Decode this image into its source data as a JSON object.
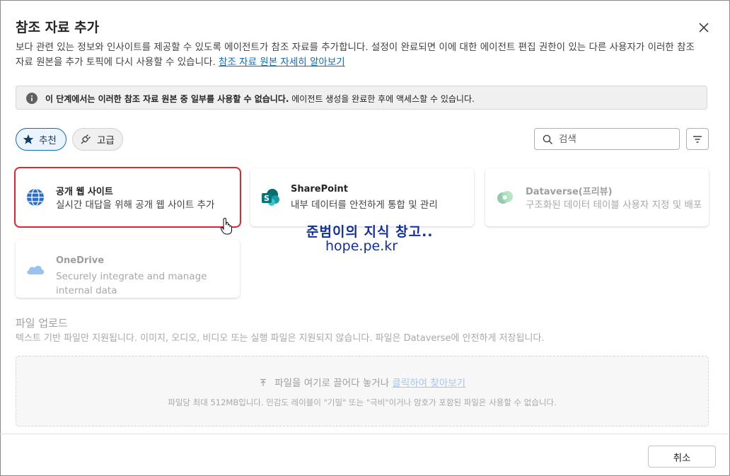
{
  "dialog": {
    "title": "참조 자료 추가",
    "description": "보다 관련 있는 정보와 인사이트를 제공할 수 있도록 에이전트가 참조 자료를 추가합니다. 설정이 완료되면 이에 대한 에이전트 편집 권한이 있는 다른 사용자가 이러한 참조 자료 원본을 추가 토픽에 다시 사용할 수 있습니다.",
    "learn_more_link": "참조 자료 원본 자세히 알아보기"
  },
  "info_banner": {
    "bold_text": "이 단계에서는 이러한 참조 자료 원본 중 일부를 사용할 수 없습니다.",
    "text": "에이전트 생성을 완료한 후에 액세스할 수 있습니다."
  },
  "filters": {
    "recommended": "추천",
    "advanced": "고급",
    "search_placeholder": "검색"
  },
  "sources": [
    {
      "name": "공개 웹 사이트",
      "description": "실시간 대답을 위해 공개 웹 사이트 추가",
      "icon": "globe-icon"
    },
    {
      "name": "SharePoint",
      "description": "내부 데이터를 안전하게 통합 및 관리",
      "icon": "sharepoint-icon"
    },
    {
      "name": "Dataverse(프리뷰)",
      "description": "구조화된 데이터 테이블 사용자 지정 및 배포",
      "icon": "dataverse-icon"
    },
    {
      "name": "OneDrive",
      "description": "Securely integrate and manage internal data",
      "icon": "onedrive-icon"
    }
  ],
  "watermark": {
    "line1": "준범이의 지식 창고..",
    "line2": "hope.pe.kr"
  },
  "upload": {
    "title": "파일 업로드",
    "description": "텍스트 기반 파일만 지원됩니다. 이미지, 오디오, 비디오 또는 실행 파일은 지원되지 않습니다. 파일은 Dataverse에 안전하게 저장됩니다.",
    "drop_text": "파일을 여기로 끌어다 놓거나",
    "browse_link": "클릭하여 찾아보기",
    "limit_text": "파일당 최대 512MB입니다. 민감도 레이블이 \"기밀\" 또는 \"극비\"이거나 암호가 포함된 파일은 사용할 수 없습니다."
  },
  "footer": {
    "cancel_label": "취소"
  },
  "colors": {
    "accent": "#0f6cbd",
    "selection": "#e0252e"
  }
}
